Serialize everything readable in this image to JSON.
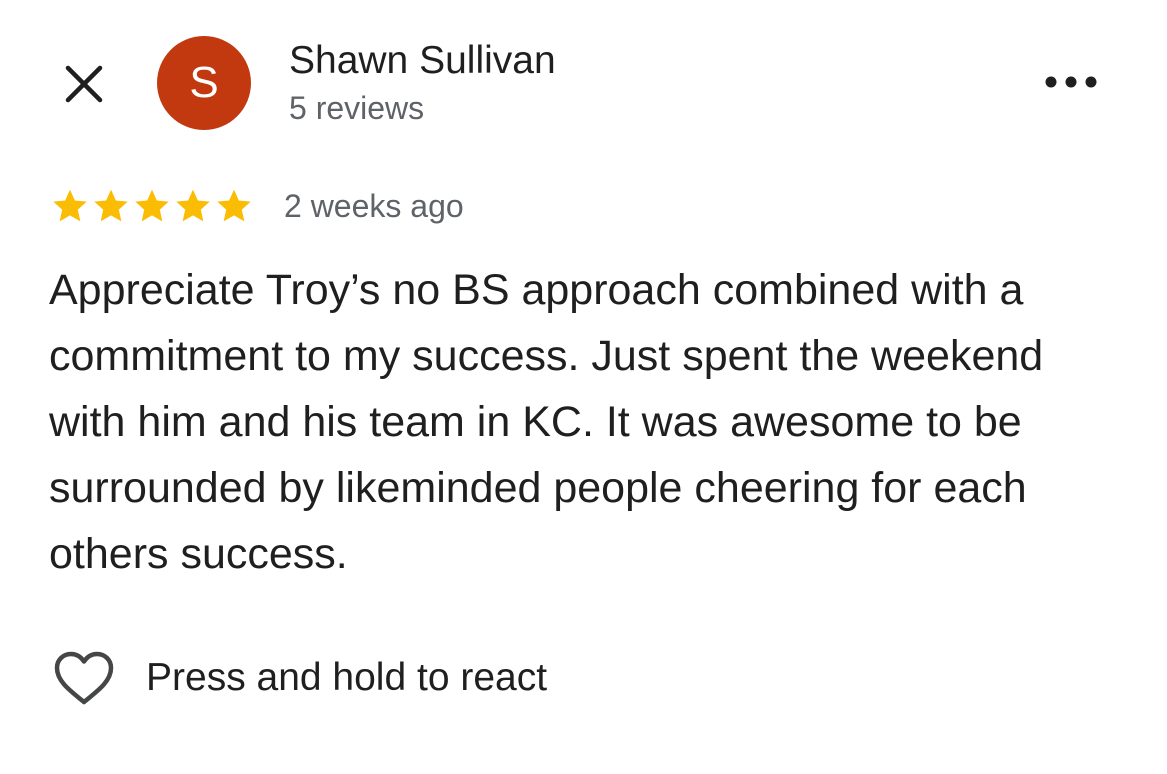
{
  "header": {
    "close_icon": "close-icon",
    "avatar_initial": "S",
    "avatar_color": "#c2380f",
    "author_name": "Shawn Sullivan",
    "review_count": "5 reviews",
    "more_icon": "more-horizontal-icon"
  },
  "review": {
    "rating": 5,
    "rating_max": 5,
    "star_color": "#fbbc04",
    "date": "2 weeks ago",
    "text": "Appreciate Troy’s no BS approach combined with a commitment to my success. Just spent the weekend with him and his team in KC. It was awesome to be surrounded by likeminded people cheering for each others success."
  },
  "reaction": {
    "icon": "heart-outline-icon",
    "label": "Press and hold to react"
  }
}
